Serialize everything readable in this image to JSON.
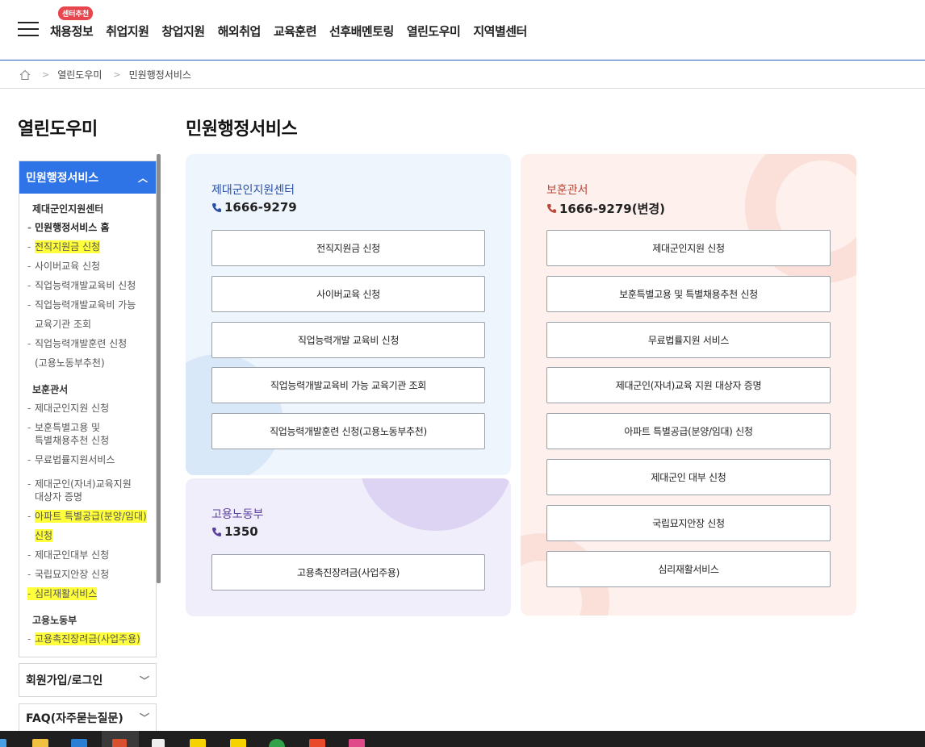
{
  "header": {
    "badge": "센터추천",
    "nav": [
      "채용정보",
      "취업지원",
      "창업지원",
      "해외취업",
      "교육훈련",
      "선후배멘토링",
      "열린도우미",
      "지역별센터"
    ]
  },
  "breadcrumb": [
    "열린도우미",
    "민원행정서비스"
  ],
  "lnb": {
    "title": "열린도우미",
    "active_section": "민원행정서비스",
    "groups": [
      {
        "title": "제대군인지원센터",
        "items": [
          {
            "text": "민원행정서비스 홈"
          },
          {
            "text": "전직지원금 신청"
          },
          {
            "text": "사이버교육 신청"
          },
          {
            "text": "직업능력개발교육비 신청"
          },
          {
            "text": "직업능력개발교육비 가능"
          },
          {
            "text": "교육기관 조회"
          },
          {
            "text": "직업능력개발훈련 신청"
          },
          {
            "text": "(고용노동부추천)"
          }
        ]
      },
      {
        "title": "보훈관서",
        "items": [
          {
            "text": "제대군인지원 신청"
          },
          {
            "text": "보훈특별고용 및"
          },
          {
            "text": "특별채용추천 신청"
          },
          {
            "text": "무료법률지원서비스"
          },
          {
            "text": "제대군인(자녀)교육지원"
          },
          {
            "text": "대상자 증명"
          },
          {
            "text": "아파트 특별공급(분양/임대)"
          },
          {
            "text": "신청"
          },
          {
            "text": "제대군인대부 신청"
          },
          {
            "text": "국립묘지안장 신청"
          },
          {
            "text": "심리재활서비스"
          }
        ]
      },
      {
        "title": "고용노동부",
        "items": [
          {
            "text": "고용촉진장려금(사업주용)"
          }
        ]
      }
    ],
    "accordions": [
      "회원가입/로그인",
      "FAQ(자주묻는질문)"
    ]
  },
  "main": {
    "title": "민원행정서비스",
    "panels": {
      "center": {
        "org": "제대군인지원센터",
        "tel": "1666-9279",
        "buttons": [
          "전직지원금 신청",
          "사이버교육 신청",
          "직업능력개발 교육비 신청",
          "직업능력개발교육비 가능 교육기관 조회",
          "직업능력개발훈련 신청(고용노동부추천)"
        ]
      },
      "labor": {
        "org": "고용노동부",
        "tel": "1350",
        "buttons": [
          "고용촉진장려금(사업주용)"
        ]
      },
      "veterans": {
        "org": "보훈관서",
        "tel": "1666-9279(변경)",
        "buttons": [
          "제대군인지원 신청",
          "보훈특별고용 및 특별채용추천 신청",
          "무료법률지원 서비스",
          "제대군인(자녀)교육 지원 대상자 증명",
          "아파트 특별공급(분양/임대) 신청",
          "제대군인 대부 신청",
          "국립묘지안장 신청",
          "심리재활서비스"
        ]
      }
    }
  },
  "colors": {
    "accent_blue": "#2e74e6",
    "org_blue": "#2a4fa8",
    "org_purple": "#5b3e9e",
    "org_red": "#b94a3a",
    "highlight": "#ffff3c"
  }
}
